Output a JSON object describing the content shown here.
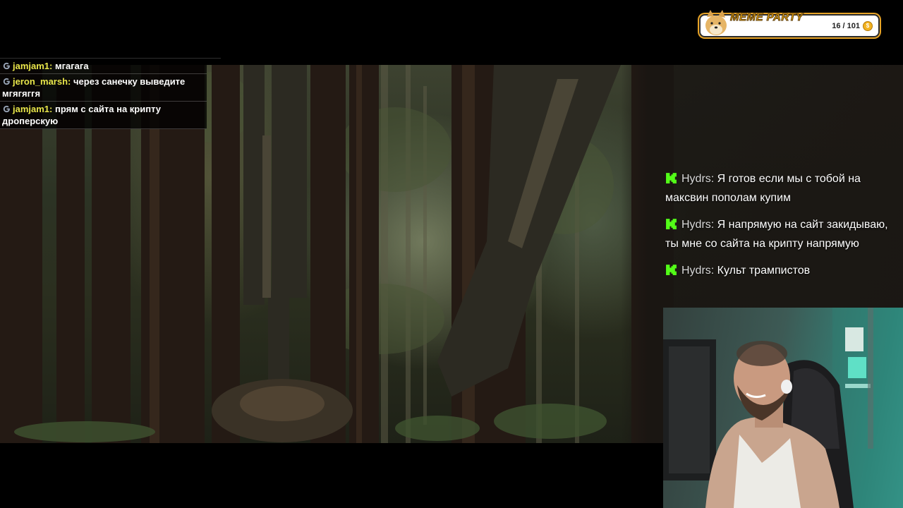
{
  "stream": {
    "scene_description_icon": "forest-video"
  },
  "left_chat": {
    "messages": [
      {
        "user": "jamjam1",
        "text": "мгагага"
      },
      {
        "user": "jeron_marsh",
        "text": "через санечку выведите мгягяггя"
      },
      {
        "user": "jamjam1",
        "text": "прям с сайта на крипту дроперскую"
      }
    ],
    "name_color": "#e8e64a"
  },
  "meme_party": {
    "title": "MEME PARTY",
    "count": "16 / 101",
    "coin_icon": "coin-icon",
    "avatar_icon": "doge-icon"
  },
  "right_chat": {
    "messages": [
      {
        "user": "Hydrs",
        "text": "Я готов если мы с тобой на максвин пополам купим"
      },
      {
        "user": "Hydrs",
        "text": "Я напрямую на сайт закидываю, ты мне со сайта на крипту напрямую"
      },
      {
        "user": "Hydrs",
        "text": "Культ трампистов"
      }
    ],
    "badge_icon": "kick-icon",
    "badge_color": "#53fc18"
  }
}
